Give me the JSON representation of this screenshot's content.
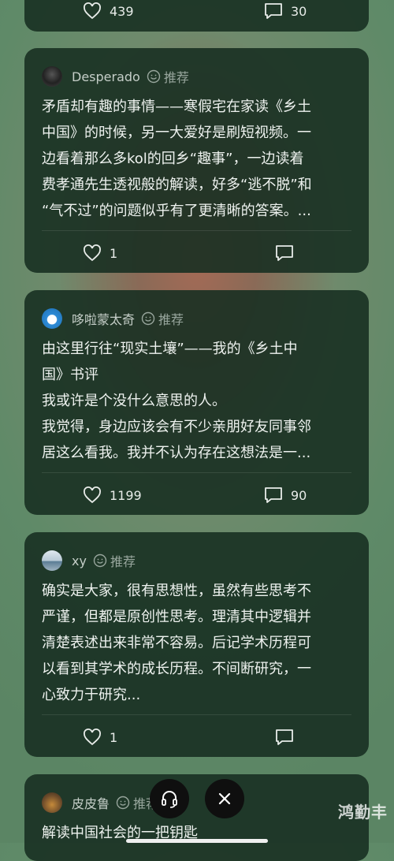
{
  "top_card": {
    "likes": "439",
    "comments": "30"
  },
  "posts": [
    {
      "username": "Desperado",
      "tag": "推荐",
      "lines": [
        "矛盾却有趣的事情——寒假宅在家读《乡土",
        "中国》的时候，另一大爱好是刷短视频。一",
        "边看着那么多kol的回乡“趣事”，一边读着",
        "费孝通先生透视般的解读，好多“逃不脱”和",
        "“气不过”的问题似乎有了更清晰的答案。..."
      ],
      "likes": "1",
      "comments": ""
    },
    {
      "username": "哆啦蒙太奇",
      "tag": "推荐",
      "lines": [
        "由这里行往“现实土壤”——我的《乡土中",
        "国》书评",
        "我或许是个没什么意思的人。",
        "我觉得，身边应该会有不少亲朋好友同事邻",
        "居这么看我。我并不认为存在这想法是一..."
      ],
      "likes": "1199",
      "comments": "90"
    },
    {
      "username": "xy",
      "tag": "推荐",
      "lines": [
        "确实是大家，很有思想性，虽然有些思考不",
        "严谨，但都是原创性思考。理清其中逻辑并",
        "清楚表述出来非常不容易。后记学术历程可",
        "以看到其学术的成长历程。不间断研究，一",
        "心致力于研究..."
      ],
      "likes": "1",
      "comments": ""
    },
    {
      "username": "皮皮鲁",
      "tag": "推荐",
      "lines": [
        "解读中国社会的一把钥匙"
      ]
    }
  ],
  "watermark": "鸿勤丰",
  "icons": {
    "like": "heart-icon",
    "comment": "comment-icon",
    "recommend": "smile-icon",
    "headphone": "headphone-icon",
    "close": "close-icon"
  }
}
